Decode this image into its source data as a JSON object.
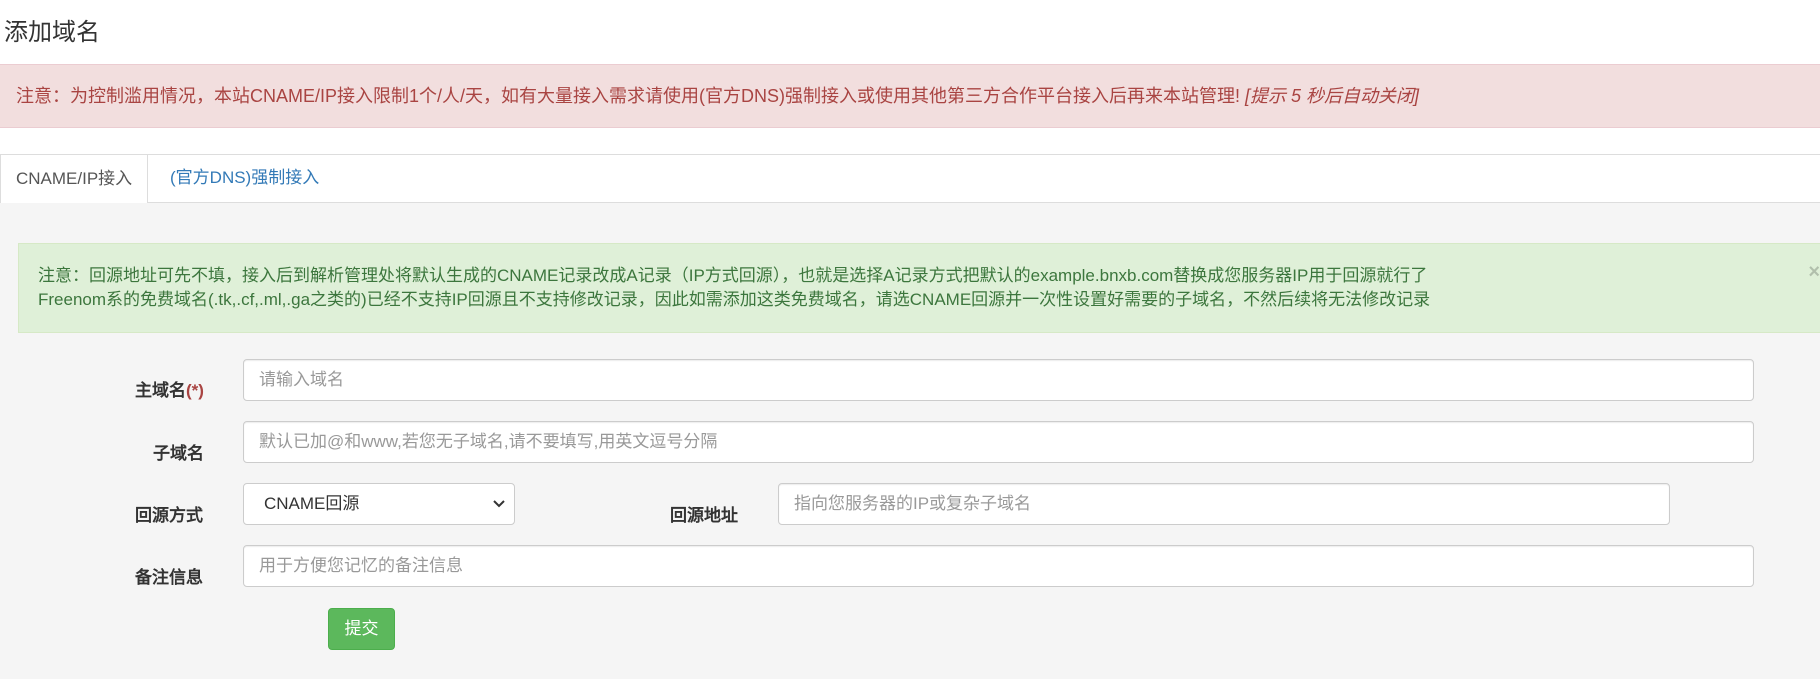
{
  "page": {
    "title": "添加域名"
  },
  "notice_danger": {
    "text": "注意：为控制滥用情况，本站CNAME/IP接入限制1个/人/天，如有大量接入需求请使用(官方DNS)强制接入或使用其他第三方合作平台接入后再来本站管理!",
    "hint": "[提示 5 秒后自动关闭]"
  },
  "tabs": [
    {
      "label": "CNAME/IP接入",
      "active": true
    },
    {
      "label": "(官方DNS)强制接入",
      "active": false
    }
  ],
  "notice_success": {
    "line1": "注意：回源地址可先不填，接入后到解析管理处将默认生成的CNAME记录改成A记录（IP方式回源），也就是选择A记录方式把默认的example.bnxb.com替换成您服务器IP用于回源就行了",
    "line2": "Freenom系的免费域名(.tk,.cf,.ml,.ga之类的)已经不支持IP回源且不支持修改记录，因此如需添加这类免费域名，请选CNAME回源并一次性设置好需要的子域名，不然后续将无法修改记录",
    "close_label": "×"
  },
  "form": {
    "main_domain": {
      "label": "主域名",
      "required_mark": "(*)",
      "placeholder": "请输入域名",
      "value": ""
    },
    "subdomain": {
      "label": "子域名",
      "placeholder": "默认已加@和www,若您无子域名,请不要填写,用英文逗号分隔",
      "value": ""
    },
    "origin_method": {
      "label": "回源方式",
      "selected": "CNAME回源"
    },
    "origin_address": {
      "label": "回源地址",
      "placeholder": "指向您服务器的IP或复杂子域名",
      "value": ""
    },
    "remark": {
      "label": "备注信息",
      "placeholder": "用于方便您记忆的备注信息",
      "value": ""
    },
    "submit_label": "提交"
  },
  "colors": {
    "danger_bg": "#f2dede",
    "danger_text": "#a94442",
    "success_bg": "#dff0d8",
    "success_text": "#3c763d",
    "link": "#337ab7",
    "submit_bg": "#5cb85c"
  },
  "icons": {
    "select_arrow": "chevron-down-icon",
    "close": "close-icon"
  }
}
